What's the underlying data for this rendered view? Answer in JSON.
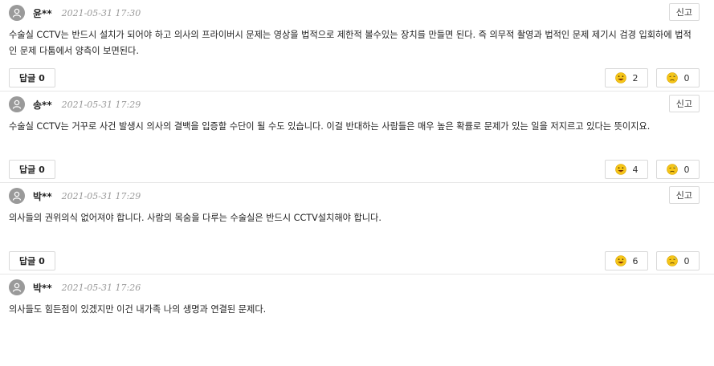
{
  "comments": [
    {
      "author": "윤**",
      "date": "2021-05-31 17:30",
      "report": "신고",
      "body": "수술실 CCTV는 반드시 설치가 되어야 하고 의사의 프라이버시 문제는 영상을 법적으로 제한적 볼수있는 장치를 만들면 된다. 즉 의무적 촬영과 법적인 문제 제기시 검경 입회하에 법적인 문제 다툼에서 양측이 보면된다.",
      "reply": "답글 0",
      "like": "2",
      "dislike": "0"
    },
    {
      "author": "송**",
      "date": "2021-05-31 17:29",
      "report": "신고",
      "body": "수술실 CCTV는 거꾸로 사건 발생시 의사의 결백을 입증할 수단이 될 수도 있습니다. 이걸 반대하는 사람들은 매우 높은 확률로 문제가 있는 일을 저지르고 있다는 뜻이지요.",
      "reply": "답글 0",
      "like": "4",
      "dislike": "0"
    },
    {
      "author": "박**",
      "date": "2021-05-31 17:29",
      "report": "신고",
      "body": "의사들의 권위의식 없어져야 합니다. 사람의 목숨을 다루는 수술실은 반드시 CCTV설치해야 합니다.",
      "reply": "답글 0",
      "like": "6",
      "dislike": "0"
    },
    {
      "author": "박**",
      "date": "2021-05-31 17:26",
      "body": "의사들도 힘든점이 있겠지만 이건 내가족 나의 생명과 연결된 문제다."
    }
  ],
  "icons": {
    "avatar": "user-avatar-icon",
    "like": "laughing-face-icon",
    "dislike": "sad-face-icon"
  },
  "colors": {
    "avatar": "#9a9a9a",
    "border": "#d9d9d9",
    "emoji": "#f5c518",
    "tongue": "#e84a4a"
  }
}
